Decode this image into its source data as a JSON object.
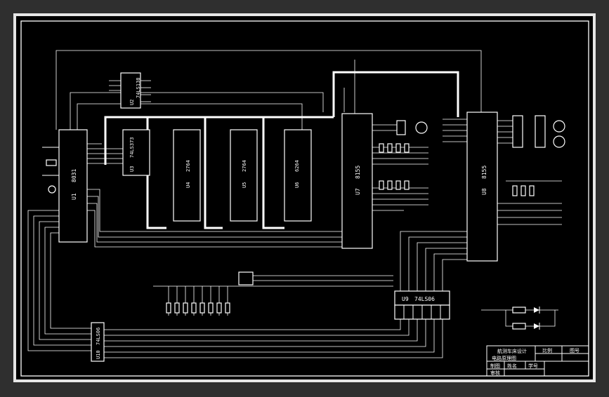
{
  "chips": {
    "u1": {
      "ref": "U1",
      "part": "8031"
    },
    "u2": {
      "ref": "U2",
      "part": "74LS138"
    },
    "u3": {
      "ref": "U3",
      "part": "74LS373"
    },
    "u4": {
      "ref": "U4",
      "part": "2764"
    },
    "u5": {
      "ref": "U5",
      "part": "2764"
    },
    "u6": {
      "ref": "U6",
      "part": "6264"
    },
    "u7": {
      "ref": "U7",
      "part": "8155"
    },
    "u8": {
      "ref": "U8",
      "part": "8155"
    },
    "u9": {
      "ref": "U9",
      "part": "74LS06"
    },
    "u10": {
      "ref": "U10",
      "part": "74LS06"
    }
  },
  "title_block": {
    "title_line1": "航测车床设计",
    "title_line2": "电路原理图",
    "scale_label": "比例",
    "drawing_no_label": "图号",
    "drafted_label": "制图",
    "name_label": "姓名",
    "student_id_label": "学号",
    "reviewed_label": "审核"
  },
  "colors": {
    "frame_outer": "#e6e6e6",
    "background": "#000000",
    "lines": "#ffffff",
    "page_border": "#2f2f2f"
  }
}
